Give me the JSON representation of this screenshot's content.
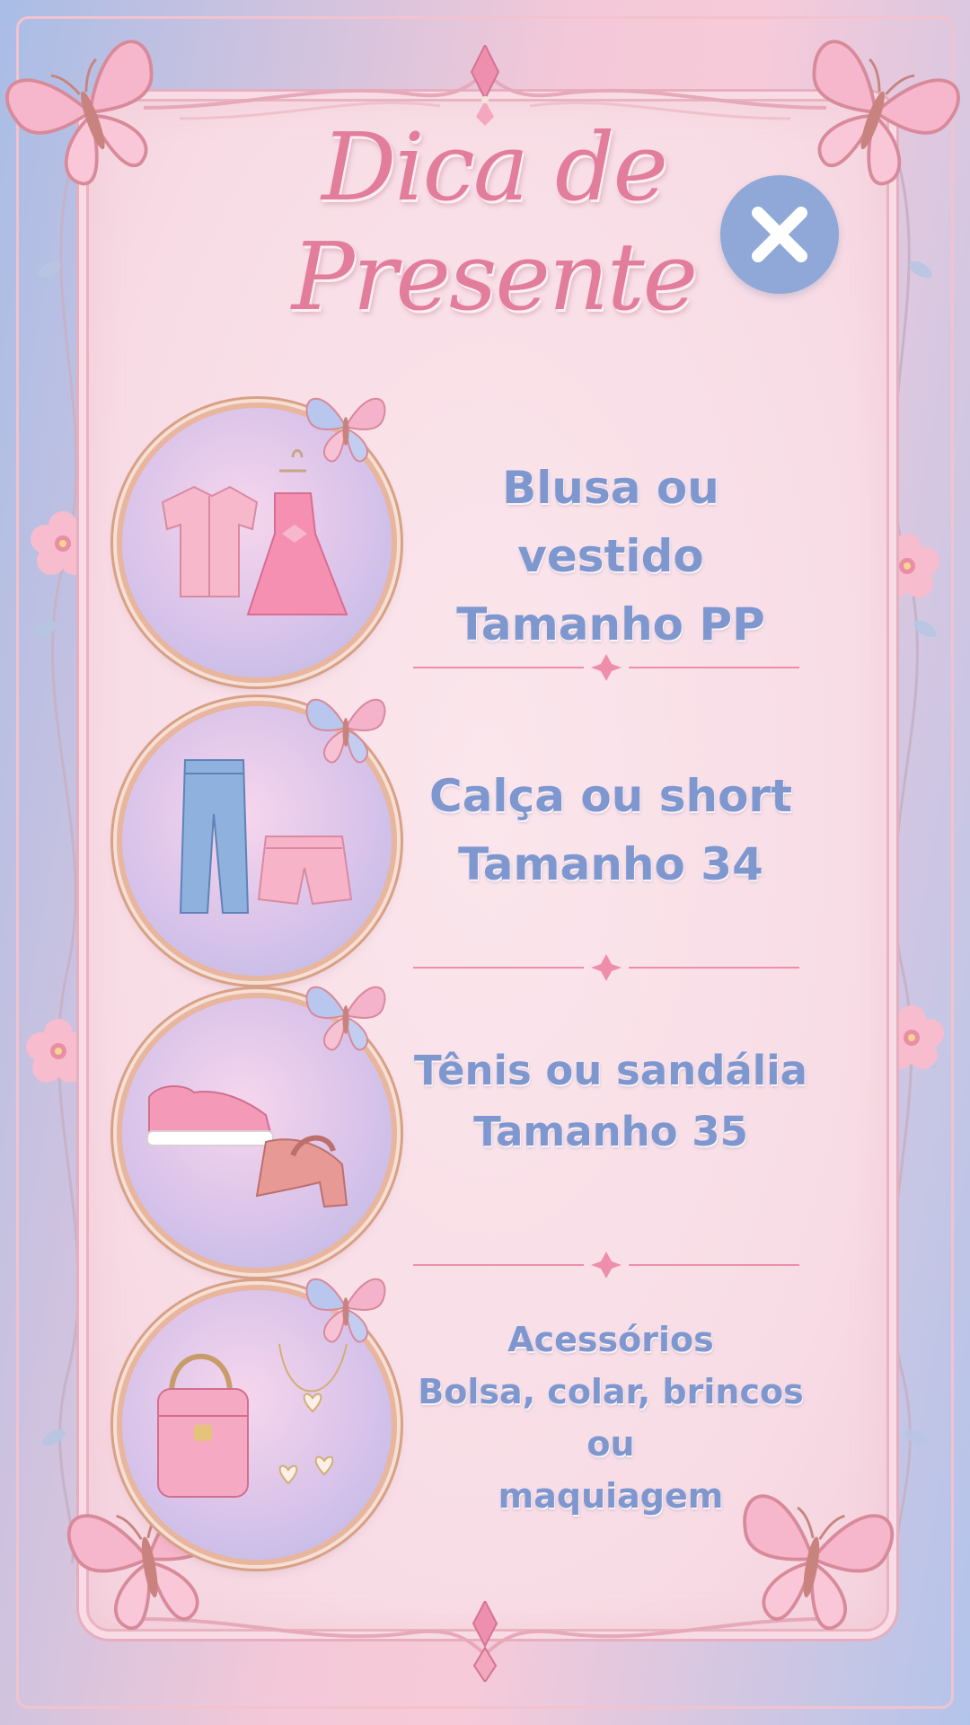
{
  "title": {
    "line1": "Dica de",
    "line2": "Presente"
  },
  "close": {
    "icon": "close-icon"
  },
  "items": [
    {
      "line1": "Blusa ou vestido",
      "line2": "Tamanho PP",
      "icon": "blouse-and-dress-icon"
    },
    {
      "line1": "Calça ou short",
      "line2": "Tamanho 34",
      "icon": "jeans-and-shorts-icon"
    },
    {
      "line1": "Tênis ou sandália",
      "line2": "Tamanho 35",
      "icon": "sneaker-and-sandal-icon"
    },
    {
      "line1": "Acessórios",
      "line2": "Bolsa, colar, brincos ou",
      "line3": "maquiagem",
      "icon": "bag-and-jewelry-icon"
    }
  ],
  "colors": {
    "title_pink": "#e27d9c",
    "text_blue": "#7f97cf",
    "close_blue": "#8fa8d8",
    "divider_pink": "#ee8eab"
  }
}
